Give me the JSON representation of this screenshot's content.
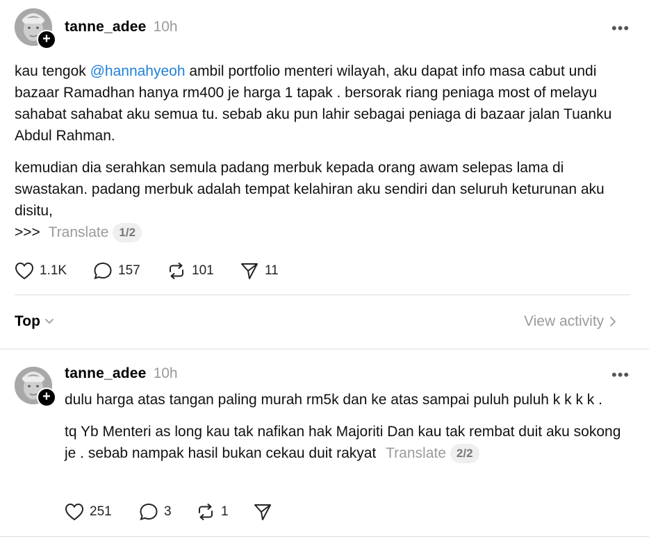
{
  "post": {
    "username": "tanne_adee",
    "time": "10h",
    "more": "•••",
    "mention": "@hannahyeoh",
    "p1_before": "kau tengok ",
    "p1_after": " ambil portfolio menteri wilayah, aku dapat info masa cabut undi bazaar Ramadhan hanya rm400 je harga 1 tapak . bersorak riang peniaga most of melayu sahabat sahabat aku semua tu. sebab aku pun lahir sebagai peniaga di bazaar jalan Tuanku Abdul Rahman.",
    "p2": "kemudian dia serahkan semula padang merbuk kepada orang awam selepas lama di swastakan. padang merbuk adalah tempat kelahiran aku sendiri dan seluruh keturunan aku disitu,",
    "p3_prefix": ">>>",
    "translate": "Translate",
    "page_indicator": "1/2",
    "actions": {
      "likes": "1.1K",
      "replies": "157",
      "reposts": "101",
      "shares": "11"
    }
  },
  "sort_bar": {
    "sort_label": "Top",
    "view_activity": "View activity"
  },
  "reply": {
    "username": "tanne_adee",
    "time": "10h",
    "more": "•••",
    "p1": "dulu harga atas tangan paling murah rm5k dan ke atas sampai puluh puluh k k k k .",
    "p2": "tq Yb Menteri as long kau tak nafikan hak Majoriti Dan kau tak rembat duit aku sokong je . sebab nampak hasil bukan cekau duit rakyat",
    "translate": "Translate",
    "page_indicator": "2/2",
    "actions": {
      "likes": "251",
      "replies": "3",
      "reposts": "1"
    }
  }
}
